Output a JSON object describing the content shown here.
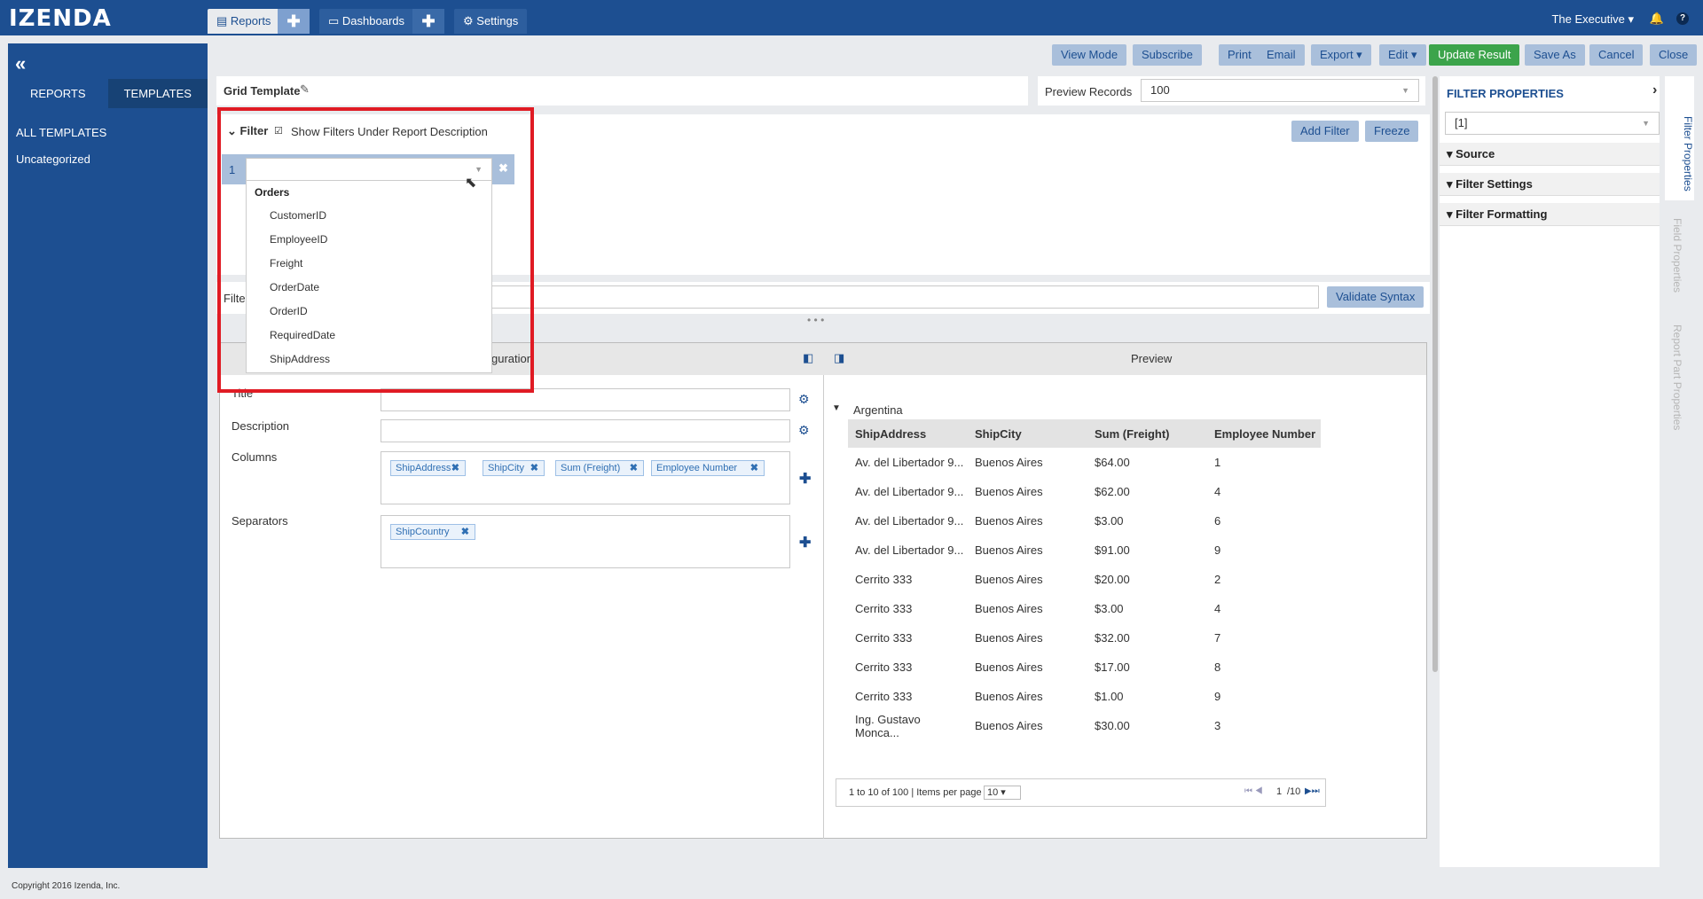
{
  "brand": {
    "logo": "IZENDA"
  },
  "nav": {
    "reports": "Reports",
    "dashboards": "Dashboards",
    "settings": "Settings",
    "plus": "✚"
  },
  "user": {
    "name": "The Executive ▾"
  },
  "left": {
    "tabs": [
      "REPORTS",
      "TEMPLATES"
    ],
    "all": "ALL TEMPLATES",
    "uncat": "Uncategorized"
  },
  "toolbar": [
    "View Mode",
    "Subscribe",
    "Print",
    "Email",
    "Export ▾",
    "Edit ▾",
    "Update Result",
    "Save As",
    "Cancel",
    "Close"
  ],
  "header": {
    "title": "Grid Template",
    "preview_label": "Preview Records",
    "preview_value": "100"
  },
  "filter": {
    "label": "Filter",
    "show_under": "Show Filters Under Report Description",
    "add": "Add Filter",
    "freeze": "Freeze",
    "row_num": "1",
    "logic_label": "Filte",
    "validate": "Validate Syntax"
  },
  "dropdown": {
    "group": "Orders",
    "options": [
      "CustomerID",
      "EmployeeID",
      "Freight",
      "OrderDate",
      "OrderID",
      "RequiredDate",
      "ShipAddress"
    ]
  },
  "config": {
    "header_partial": "guration",
    "preview_header": "Preview",
    "title_label": "Title",
    "desc_label": "Description",
    "columns_label": "Columns",
    "sep_label": "Separators",
    "columns": [
      "ShipAddress",
      "ShipCity",
      "Sum (Freight)",
      "Employee Number"
    ],
    "separators": [
      "ShipCountry"
    ]
  },
  "preview": {
    "group": "Argentina",
    "headers": [
      "ShipAddress",
      "ShipCity",
      "Sum (Freight)",
      "Employee Number"
    ],
    "rows": [
      [
        "Av. del Libertador 9...",
        "Buenos Aires",
        "$64.00",
        "1"
      ],
      [
        "Av. del Libertador 9...",
        "Buenos Aires",
        "$62.00",
        "4"
      ],
      [
        "Av. del Libertador 9...",
        "Buenos Aires",
        "$3.00",
        "6"
      ],
      [
        "Av. del Libertador 9...",
        "Buenos Aires",
        "$91.00",
        "9"
      ],
      [
        "Cerrito 333",
        "Buenos Aires",
        "$20.00",
        "2"
      ],
      [
        "Cerrito 333",
        "Buenos Aires",
        "$3.00",
        "4"
      ],
      [
        "Cerrito 333",
        "Buenos Aires",
        "$32.00",
        "7"
      ],
      [
        "Cerrito 333",
        "Buenos Aires",
        "$17.00",
        "8"
      ],
      [
        "Cerrito 333",
        "Buenos Aires",
        "$1.00",
        "9"
      ],
      [
        "Ing. Gustavo Monca...",
        "Buenos Aires",
        "$30.00",
        "3"
      ]
    ],
    "pager_text": "1 to 10 of 100 | Items per page",
    "per_page": "10",
    "page": "1",
    "pages": "/10"
  },
  "right": {
    "title": "FILTER PROPERTIES",
    "select": "[1]",
    "sections": [
      "Source",
      "Filter Settings",
      "Filter Formatting"
    ],
    "vtabs": [
      "Filter Properties",
      "Field Properties",
      "Report Part Properties"
    ]
  },
  "footer": "Copyright 2016 Izenda, Inc."
}
